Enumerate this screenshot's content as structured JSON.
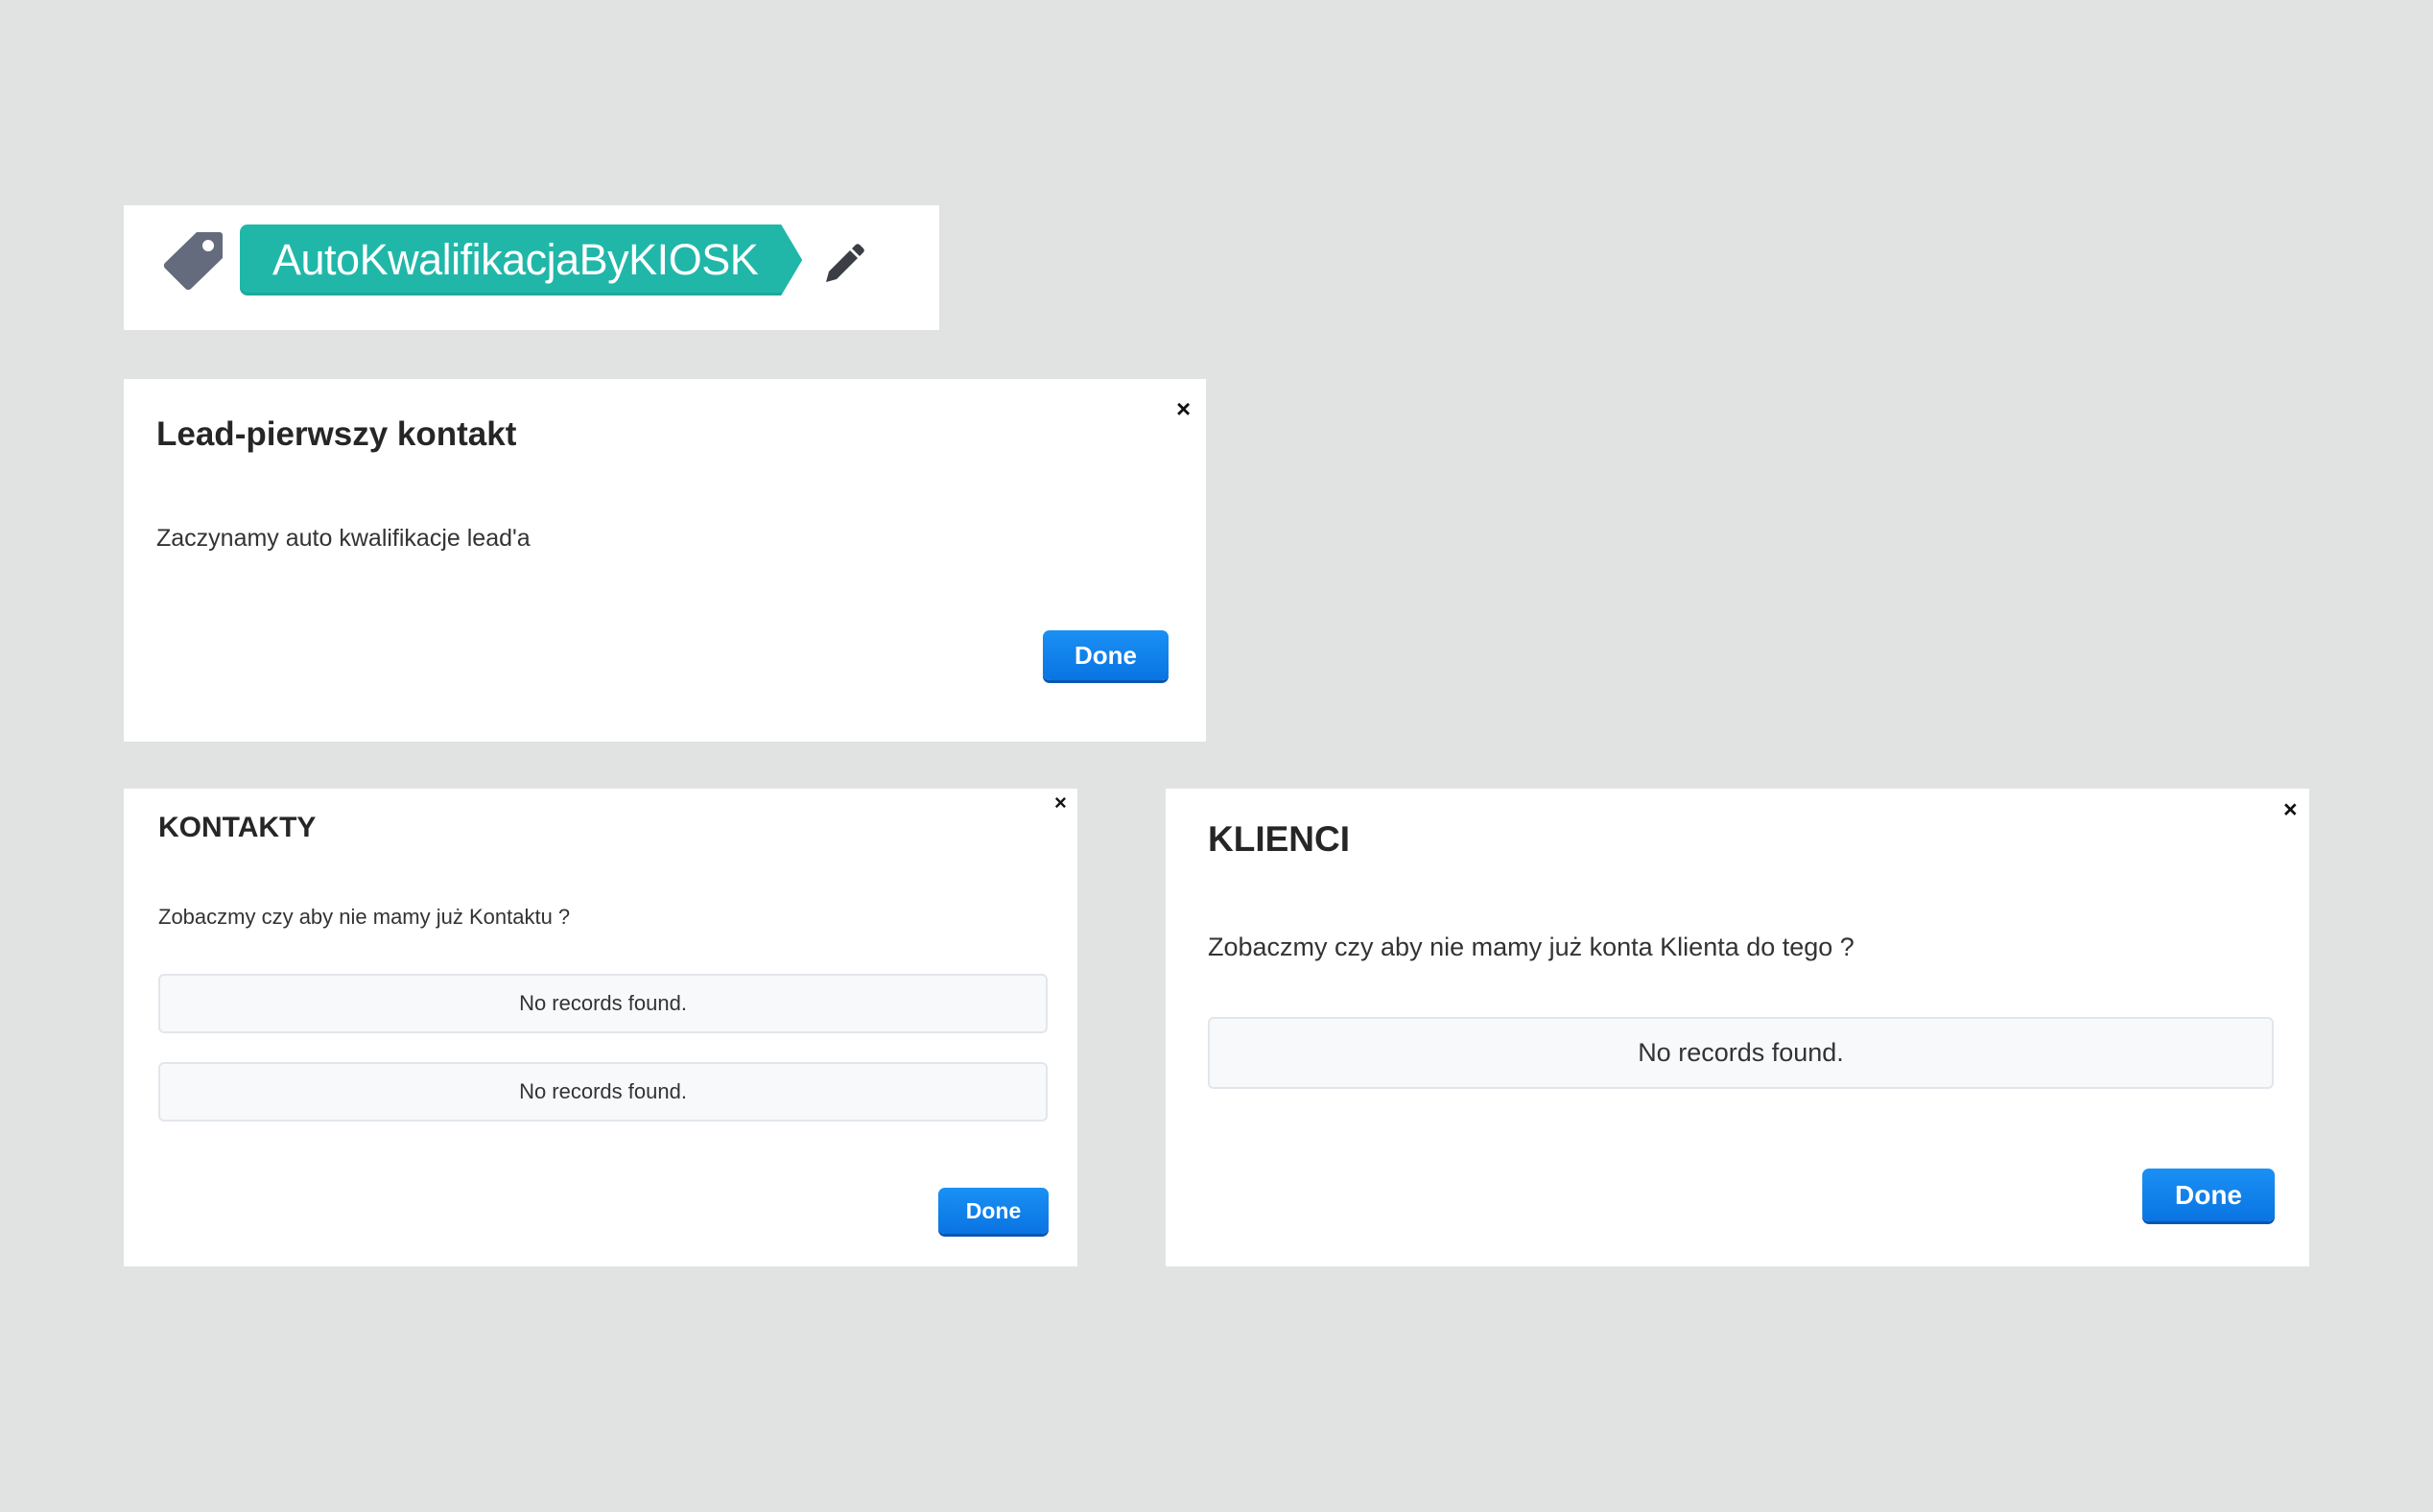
{
  "tag_panel": {
    "tag_label": "AutoKwalifikacjaByKIOSK",
    "tag_icon": "tag-icon",
    "edit_icon": "pencil-icon",
    "tag_color": "#20b7a9"
  },
  "dialog_lead": {
    "title": "Lead-pierwszy kontakt",
    "message": "Zaczynamy auto kwalifikacje lead'a",
    "close_label": "×",
    "done_label": "Done"
  },
  "dialog_kontakty": {
    "title": "KONTAKTY",
    "message": "Zobaczmy czy aby nie mamy już Kontaktu ?",
    "records": [
      "No records found.",
      "No records found."
    ],
    "close_label": "×",
    "done_label": "Done"
  },
  "dialog_klienci": {
    "title": "KLIENCI",
    "message": "Zobaczmy czy aby nie mamy już konta Klienta do tego ?",
    "records": [
      "No records found."
    ],
    "close_label": "×",
    "done_label": "Done"
  },
  "colors": {
    "background": "#e1e3e2",
    "button_primary": "#0a74e2"
  }
}
